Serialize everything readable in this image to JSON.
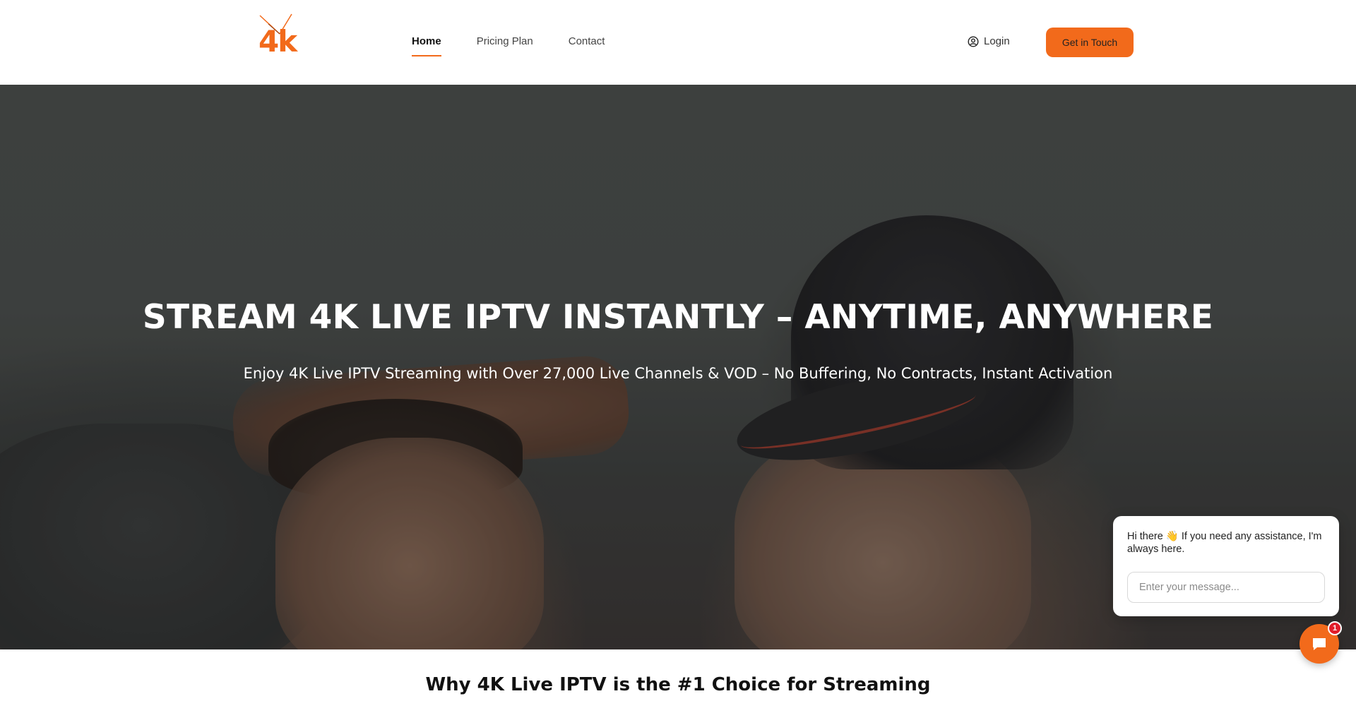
{
  "header": {
    "logo_text": "4k",
    "nav": [
      {
        "label": "Home",
        "active": true
      },
      {
        "label": "Pricing Plan",
        "active": false
      },
      {
        "label": "Contact",
        "active": false
      }
    ],
    "login_label": "Login",
    "cta_label": "Get in Touch"
  },
  "hero": {
    "title": "STREAM 4K LIVE IPTV INSTANTLY – ANYTIME, ANYWHERE",
    "subtitle": "Enjoy 4K Live IPTV Streaming with Over 27,000 Live Channels & VOD – No Buffering, No Contracts, Instant Activation"
  },
  "section": {
    "title": "Why 4K Live IPTV is the #1 Choice for Streaming"
  },
  "chat": {
    "greeting": "Hi there 👋 If you need any assistance, I'm always here.",
    "input_placeholder": "Enter your message...",
    "badge_count": "1"
  },
  "colors": {
    "accent": "#f26a1b",
    "badge": "#e11d2a"
  },
  "icons": {
    "login": "user-circle-icon",
    "chat": "chat-icon"
  }
}
